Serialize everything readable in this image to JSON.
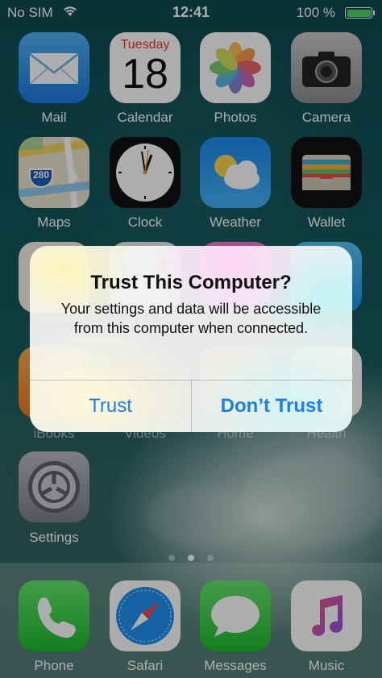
{
  "status_bar": {
    "carrier": "No SIM",
    "time": "12:41",
    "battery_percent": "100 %",
    "battery_level": 1.0
  },
  "apps": {
    "mail": "Mail",
    "calendar": "Calendar",
    "calendar_day": "Tuesday",
    "calendar_date": "18",
    "photos": "Photos",
    "camera": "Camera",
    "maps": "Maps",
    "maps_shield": "280",
    "clock": "Clock",
    "weather": "Weather",
    "wallet": "Wallet",
    "ibooks": "iBooks",
    "videos": "Videos",
    "home": "Home",
    "health": "Health",
    "settings": "Settings"
  },
  "dock": {
    "phone": "Phone",
    "safari": "Safari",
    "messages": "Messages",
    "music": "Music"
  },
  "alert": {
    "title": "Trust This Computer?",
    "message": "Your settings and data will be accessible from this computer when connected.",
    "trust_label": "Trust",
    "dont_trust_label": "Don’t Trust",
    "accent_color": "#1a7ef0"
  }
}
